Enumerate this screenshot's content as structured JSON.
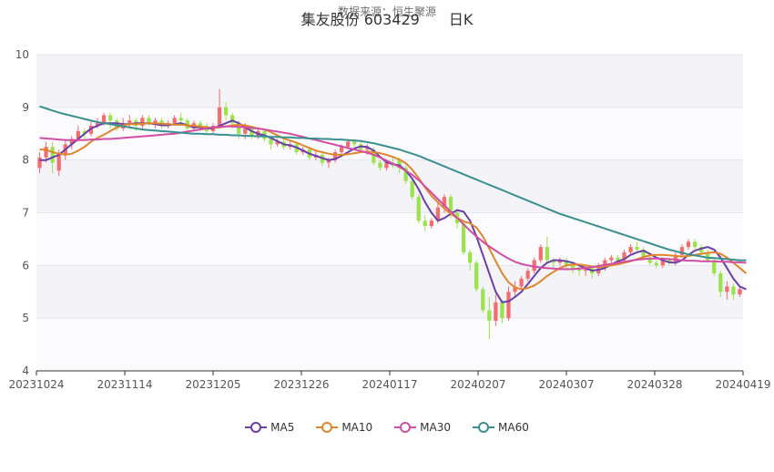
{
  "header": {
    "title": "集友股份 603429　　日K",
    "subtitle": "数据来源：恒生聚源"
  },
  "chart_data": {
    "type": "candlestick",
    "title": "集友股份 603429　　日K",
    "ylim": [
      4,
      10
    ],
    "y_ticks": [
      "4",
      "5",
      "6",
      "7",
      "8",
      "9",
      "10"
    ],
    "x_tick_labels": [
      "20231024",
      "20231114",
      "20231205",
      "20231226",
      "20240117",
      "20240207",
      "20240307",
      "20240328",
      "20240419"
    ],
    "grid": true,
    "legend_position": "bottom",
    "up_color": "#f26d6d",
    "down_color": "#9be34b",
    "candles": [
      {
        "o": 7.85,
        "c": 8.05,
        "h": 8.15,
        "l": 7.75
      },
      {
        "o": 8.05,
        "c": 8.25,
        "h": 8.35,
        "l": 7.95
      },
      {
        "o": 8.25,
        "c": 7.95,
        "h": 8.35,
        "l": 7.75
      },
      {
        "o": 7.8,
        "c": 8.1,
        "h": 8.2,
        "l": 7.7
      },
      {
        "o": 8.1,
        "c": 8.3,
        "h": 8.4,
        "l": 8.0
      },
      {
        "o": 8.3,
        "c": 8.4,
        "h": 8.45,
        "l": 8.2
      },
      {
        "o": 8.4,
        "c": 8.55,
        "h": 8.65,
        "l": 8.35
      },
      {
        "o": 8.55,
        "c": 8.5,
        "h": 8.6,
        "l": 8.4
      },
      {
        "o": 8.5,
        "c": 8.65,
        "h": 8.75,
        "l": 8.45
      },
      {
        "o": 8.65,
        "c": 8.7,
        "h": 8.8,
        "l": 8.6
      },
      {
        "o": 8.7,
        "c": 8.85,
        "h": 8.9,
        "l": 8.65
      },
      {
        "o": 8.85,
        "c": 8.75,
        "h": 8.9,
        "l": 8.6
      },
      {
        "o": 8.75,
        "c": 8.6,
        "h": 8.8,
        "l": 8.55
      },
      {
        "o": 8.6,
        "c": 8.7,
        "h": 8.8,
        "l": 8.55
      },
      {
        "o": 8.7,
        "c": 8.75,
        "h": 8.85,
        "l": 8.6
      },
      {
        "o": 8.75,
        "c": 8.65,
        "h": 8.8,
        "l": 8.55
      },
      {
        "o": 8.65,
        "c": 8.8,
        "h": 8.85,
        "l": 8.6
      },
      {
        "o": 8.8,
        "c": 8.7,
        "h": 8.85,
        "l": 8.65
      },
      {
        "o": 8.7,
        "c": 8.75,
        "h": 8.8,
        "l": 8.6
      },
      {
        "o": 8.75,
        "c": 8.65,
        "h": 8.8,
        "l": 8.6
      },
      {
        "o": 8.65,
        "c": 8.7,
        "h": 8.75,
        "l": 8.6
      },
      {
        "o": 8.7,
        "c": 8.8,
        "h": 8.85,
        "l": 8.65
      },
      {
        "o": 8.8,
        "c": 8.75,
        "h": 8.9,
        "l": 8.7
      },
      {
        "o": 8.75,
        "c": 8.6,
        "h": 8.8,
        "l": 8.5
      },
      {
        "o": 8.6,
        "c": 8.7,
        "h": 8.75,
        "l": 8.55
      },
      {
        "o": 8.7,
        "c": 8.65,
        "h": 8.75,
        "l": 8.55
      },
      {
        "o": 8.65,
        "c": 8.55,
        "h": 8.7,
        "l": 8.5
      },
      {
        "o": 8.55,
        "c": 8.65,
        "h": 8.7,
        "l": 8.5
      },
      {
        "o": 8.65,
        "c": 9.0,
        "h": 9.35,
        "l": 8.6
      },
      {
        "o": 9.0,
        "c": 8.85,
        "h": 9.1,
        "l": 8.75
      },
      {
        "o": 8.85,
        "c": 8.7,
        "h": 8.9,
        "l": 8.6
      },
      {
        "o": 8.7,
        "c": 8.5,
        "h": 8.75,
        "l": 8.4
      },
      {
        "o": 8.5,
        "c": 8.6,
        "h": 8.7,
        "l": 8.4
      },
      {
        "o": 8.6,
        "c": 8.45,
        "h": 8.65,
        "l": 8.4
      },
      {
        "o": 8.45,
        "c": 8.55,
        "h": 8.6,
        "l": 8.4
      },
      {
        "o": 8.55,
        "c": 8.4,
        "h": 8.6,
        "l": 8.35
      },
      {
        "o": 8.4,
        "c": 8.3,
        "h": 8.45,
        "l": 8.2
      },
      {
        "o": 8.3,
        "c": 8.35,
        "h": 8.4,
        "l": 8.25
      },
      {
        "o": 8.35,
        "c": 8.25,
        "h": 8.4,
        "l": 8.2
      },
      {
        "o": 8.25,
        "c": 8.3,
        "h": 8.35,
        "l": 8.2
      },
      {
        "o": 8.3,
        "c": 8.15,
        "h": 8.35,
        "l": 8.1
      },
      {
        "o": 8.15,
        "c": 8.2,
        "h": 8.25,
        "l": 8.1
      },
      {
        "o": 8.2,
        "c": 8.05,
        "h": 8.25,
        "l": 8.0
      },
      {
        "o": 8.05,
        "c": 8.1,
        "h": 8.2,
        "l": 8.0
      },
      {
        "o": 8.1,
        "c": 7.95,
        "h": 8.15,
        "l": 7.9
      },
      {
        "o": 7.95,
        "c": 8.0,
        "h": 8.05,
        "l": 7.85
      },
      {
        "o": 8.0,
        "c": 8.15,
        "h": 8.2,
        "l": 7.95
      },
      {
        "o": 8.15,
        "c": 8.25,
        "h": 8.3,
        "l": 8.1
      },
      {
        "o": 8.25,
        "c": 8.35,
        "h": 8.4,
        "l": 8.2
      },
      {
        "o": 8.35,
        "c": 8.3,
        "h": 8.4,
        "l": 8.25
      },
      {
        "o": 8.3,
        "c": 8.2,
        "h": 8.35,
        "l": 8.15
      },
      {
        "o": 8.2,
        "c": 8.25,
        "h": 8.3,
        "l": 8.1
      },
      {
        "o": 8.2,
        "c": 7.95,
        "h": 8.25,
        "l": 7.9
      },
      {
        "o": 7.95,
        "c": 7.85,
        "h": 8.0,
        "l": 7.8
      },
      {
        "o": 7.85,
        "c": 7.95,
        "h": 8.0,
        "l": 7.8
      },
      {
        "o": 7.95,
        "c": 7.9,
        "h": 8.05,
        "l": 7.85
      },
      {
        "o": 8.0,
        "c": 7.85,
        "h": 8.05,
        "l": 7.75
      },
      {
        "o": 7.85,
        "c": 7.6,
        "h": 7.9,
        "l": 7.55
      },
      {
        "o": 7.6,
        "c": 7.3,
        "h": 7.65,
        "l": 7.25
      },
      {
        "o": 7.3,
        "c": 6.85,
        "h": 7.35,
        "l": 6.8
      },
      {
        "o": 6.85,
        "c": 6.75,
        "h": 6.95,
        "l": 6.65
      },
      {
        "o": 6.75,
        "c": 6.85,
        "h": 6.9,
        "l": 6.7
      },
      {
        "o": 6.85,
        "c": 7.1,
        "h": 7.2,
        "l": 6.8
      },
      {
        "o": 7.1,
        "c": 7.3,
        "h": 7.35,
        "l": 7.0
      },
      {
        "o": 7.3,
        "c": 7.0,
        "h": 7.35,
        "l": 6.9
      },
      {
        "o": 7.0,
        "c": 6.8,
        "h": 7.05,
        "l": 6.7
      },
      {
        "o": 6.8,
        "c": 6.25,
        "h": 6.85,
        "l": 6.2
      },
      {
        "o": 6.25,
        "c": 6.05,
        "h": 6.3,
        "l": 5.9
      },
      {
        "o": 6.05,
        "c": 5.55,
        "h": 6.1,
        "l": 5.5
      },
      {
        "o": 5.55,
        "c": 5.15,
        "h": 5.6,
        "l": 5.1
      },
      {
        "o": 5.15,
        "c": 4.95,
        "h": 5.4,
        "l": 4.6
      },
      {
        "o": 4.95,
        "c": 5.3,
        "h": 5.45,
        "l": 4.85
      },
      {
        "o": 5.3,
        "c": 5.0,
        "h": 5.35,
        "l": 4.9
      },
      {
        "o": 5.0,
        "c": 5.5,
        "h": 5.6,
        "l": 4.95
      },
      {
        "o": 5.5,
        "c": 5.6,
        "h": 5.7,
        "l": 5.4
      },
      {
        "o": 5.6,
        "c": 5.75,
        "h": 5.8,
        "l": 5.55
      },
      {
        "o": 5.75,
        "c": 5.9,
        "h": 5.95,
        "l": 5.7
      },
      {
        "o": 5.9,
        "c": 6.1,
        "h": 6.15,
        "l": 5.85
      },
      {
        "o": 6.1,
        "c": 6.35,
        "h": 6.4,
        "l": 6.05
      },
      {
        "o": 6.35,
        "c": 6.1,
        "h": 6.55,
        "l": 6.05
      },
      {
        "o": 6.1,
        "c": 6.05,
        "h": 6.15,
        "l": 5.95
      },
      {
        "o": 6.05,
        "c": 6.1,
        "h": 6.15,
        "l": 6.0
      },
      {
        "o": 6.1,
        "c": 6.0,
        "h": 6.15,
        "l": 5.9
      },
      {
        "o": 6.0,
        "c": 5.95,
        "h": 6.05,
        "l": 5.85
      },
      {
        "o": 5.95,
        "c": 5.9,
        "h": 6.0,
        "l": 5.8
      },
      {
        "o": 5.9,
        "c": 5.95,
        "h": 6.0,
        "l": 5.8
      },
      {
        "o": 5.95,
        "c": 5.85,
        "h": 6.0,
        "l": 5.75
      },
      {
        "o": 5.85,
        "c": 5.95,
        "h": 6.05,
        "l": 5.8
      },
      {
        "o": 5.95,
        "c": 6.1,
        "h": 6.15,
        "l": 5.9
      },
      {
        "o": 6.1,
        "c": 6.15,
        "h": 6.2,
        "l": 6.05
      },
      {
        "o": 6.15,
        "c": 6.1,
        "h": 6.2,
        "l": 6.05
      },
      {
        "o": 6.1,
        "c": 6.25,
        "h": 6.3,
        "l": 6.05
      },
      {
        "o": 6.25,
        "c": 6.35,
        "h": 6.4,
        "l": 6.2
      },
      {
        "o": 6.35,
        "c": 6.3,
        "h": 6.45,
        "l": 6.25
      },
      {
        "o": 6.3,
        "c": 6.15,
        "h": 6.35,
        "l": 6.1
      },
      {
        "o": 6.15,
        "c": 6.05,
        "h": 6.2,
        "l": 6.0
      },
      {
        "o": 6.05,
        "c": 6.0,
        "h": 6.1,
        "l": 5.95
      },
      {
        "o": 6.0,
        "c": 6.1,
        "h": 6.15,
        "l": 5.95
      },
      {
        "o": 6.1,
        "c": 6.05,
        "h": 6.15,
        "l": 6.0
      },
      {
        "o": 6.05,
        "c": 6.2,
        "h": 6.25,
        "l": 6.0
      },
      {
        "o": 6.2,
        "c": 6.35,
        "h": 6.4,
        "l": 6.15
      },
      {
        "o": 6.35,
        "c": 6.45,
        "h": 6.5,
        "l": 6.3
      },
      {
        "o": 6.45,
        "c": 6.35,
        "h": 6.5,
        "l": 6.3
      },
      {
        "o": 6.35,
        "c": 6.25,
        "h": 6.4,
        "l": 6.2
      },
      {
        "o": 6.25,
        "c": 6.1,
        "h": 6.3,
        "l": 6.05
      },
      {
        "o": 6.1,
        "c": 5.85,
        "h": 6.15,
        "l": 5.8
      },
      {
        "o": 5.85,
        "c": 5.5,
        "h": 5.9,
        "l": 5.4
      },
      {
        "o": 5.5,
        "c": 5.6,
        "h": 5.7,
        "l": 5.35
      },
      {
        "o": 5.6,
        "c": 5.45,
        "h": 5.65,
        "l": 5.35
      },
      {
        "o": 5.45,
        "c": 5.55,
        "h": 5.6,
        "l": 5.4
      }
    ],
    "series": [
      {
        "name": "MA5",
        "color": "#6a40a8",
        "values": [
          8.0,
          8.0,
          8.05,
          8.1,
          8.2,
          8.3,
          8.4,
          8.5,
          8.6,
          8.65,
          8.7,
          8.7,
          8.7,
          8.68,
          8.68,
          8.7,
          8.7,
          8.7,
          8.68,
          8.66,
          8.66,
          8.68,
          8.7,
          8.66,
          8.62,
          8.62,
          8.6,
          8.6,
          8.65,
          8.7,
          8.75,
          8.7,
          8.62,
          8.55,
          8.5,
          8.47,
          8.42,
          8.36,
          8.3,
          8.28,
          8.24,
          8.18,
          8.12,
          8.08,
          8.04,
          8.0,
          8.02,
          8.08,
          8.15,
          8.22,
          8.26,
          8.25,
          8.18,
          8.06,
          7.96,
          7.92,
          7.9,
          7.8,
          7.65,
          7.45,
          7.2,
          7.0,
          6.85,
          6.9,
          6.98,
          7.05,
          7.02,
          6.85,
          6.55,
          6.2,
          5.85,
          5.5,
          5.3,
          5.32,
          5.4,
          5.5,
          5.65,
          5.8,
          5.95,
          6.05,
          6.1,
          6.1,
          6.08,
          6.05,
          6.0,
          5.95,
          5.9,
          5.92,
          5.95,
          6.02,
          6.08,
          6.12,
          6.2,
          6.25,
          6.28,
          6.22,
          6.15,
          6.1,
          6.06,
          6.05,
          6.1,
          6.2,
          6.28,
          6.32,
          6.35,
          6.3,
          6.15,
          5.95,
          5.75,
          5.6,
          5.55
        ]
      },
      {
        "name": "MA10",
        "color": "#e0852b",
        "values": [
          8.2,
          8.2,
          8.15,
          8.12,
          8.1,
          8.12,
          8.18,
          8.25,
          8.35,
          8.42,
          8.48,
          8.55,
          8.62,
          8.66,
          8.68,
          8.68,
          8.69,
          8.7,
          8.7,
          8.69,
          8.68,
          8.67,
          8.67,
          8.66,
          8.65,
          8.64,
          8.62,
          8.61,
          8.62,
          8.64,
          8.66,
          8.67,
          8.66,
          8.63,
          8.6,
          8.58,
          8.53,
          8.47,
          8.41,
          8.37,
          8.33,
          8.28,
          8.23,
          8.18,
          8.15,
          8.12,
          8.1,
          8.1,
          8.11,
          8.13,
          8.15,
          8.16,
          8.15,
          8.13,
          8.1,
          8.06,
          8.01,
          7.94,
          7.82,
          7.66,
          7.48,
          7.32,
          7.2,
          7.08,
          6.98,
          6.9,
          6.84,
          6.8,
          6.72,
          6.55,
          6.32,
          6.08,
          5.85,
          5.68,
          5.58,
          5.55,
          5.57,
          5.62,
          5.7,
          5.8,
          5.88,
          5.95,
          6.0,
          6.02,
          6.02,
          6.0,
          5.98,
          5.97,
          5.98,
          6.0,
          6.02,
          6.05,
          6.08,
          6.12,
          6.16,
          6.19,
          6.2,
          6.2,
          6.19,
          6.18,
          6.17,
          6.18,
          6.2,
          6.22,
          6.24,
          6.25,
          6.22,
          6.15,
          6.05,
          5.95,
          5.85
        ]
      },
      {
        "name": "MA30",
        "color": "#d24ea5",
        "values": [
          8.42,
          8.41,
          8.4,
          8.39,
          8.38,
          8.38,
          8.38,
          8.38,
          8.39,
          8.39,
          8.4,
          8.4,
          8.41,
          8.42,
          8.43,
          8.44,
          8.45,
          8.46,
          8.47,
          8.48,
          8.49,
          8.5,
          8.52,
          8.54,
          8.56,
          8.58,
          8.6,
          8.62,
          8.63,
          8.64,
          8.64,
          8.63,
          8.62,
          8.61,
          8.6,
          8.58,
          8.56,
          8.54,
          8.52,
          8.5,
          8.47,
          8.44,
          8.41,
          8.38,
          8.35,
          8.32,
          8.29,
          8.26,
          8.23,
          8.2,
          8.17,
          8.14,
          8.1,
          8.05,
          7.99,
          7.93,
          7.87,
          7.8,
          7.72,
          7.62,
          7.5,
          7.38,
          7.26,
          7.14,
          7.02,
          6.9,
          6.78,
          6.66,
          6.55,
          6.45,
          6.36,
          6.28,
          6.2,
          6.13,
          6.07,
          6.03,
          6.0,
          5.98,
          5.96,
          5.95,
          5.94,
          5.93,
          5.93,
          5.93,
          5.94,
          5.95,
          5.97,
          5.99,
          6.01,
          6.03,
          6.05,
          6.07,
          6.09,
          6.11,
          6.12,
          6.13,
          6.13,
          6.13,
          6.12,
          6.11,
          6.1,
          6.09,
          6.09,
          6.08,
          6.08,
          6.08,
          6.07,
          6.07,
          6.06,
          6.06,
          6.05
        ]
      },
      {
        "name": "MA60",
        "color": "#3a8f8f",
        "values": [
          9.02,
          8.98,
          8.94,
          8.9,
          8.87,
          8.84,
          8.81,
          8.78,
          8.75,
          8.72,
          8.7,
          8.68,
          8.66,
          8.64,
          8.62,
          8.6,
          8.58,
          8.57,
          8.56,
          8.55,
          8.54,
          8.53,
          8.52,
          8.51,
          8.5,
          8.5,
          8.49,
          8.49,
          8.48,
          8.48,
          8.47,
          8.47,
          8.46,
          8.46,
          8.45,
          8.45,
          8.44,
          8.44,
          8.43,
          8.43,
          8.42,
          8.42,
          8.41,
          8.41,
          8.4,
          8.4,
          8.39,
          8.39,
          8.38,
          8.37,
          8.36,
          8.34,
          8.32,
          8.29,
          8.26,
          8.23,
          8.2,
          8.16,
          8.12,
          8.08,
          8.03,
          7.98,
          7.93,
          7.88,
          7.83,
          7.78,
          7.73,
          7.68,
          7.63,
          7.58,
          7.53,
          7.48,
          7.43,
          7.38,
          7.33,
          7.28,
          7.23,
          7.18,
          7.13,
          7.08,
          7.03,
          6.98,
          6.94,
          6.9,
          6.86,
          6.82,
          6.78,
          6.74,
          6.7,
          6.66,
          6.62,
          6.58,
          6.54,
          6.5,
          6.46,
          6.42,
          6.38,
          6.34,
          6.3,
          6.27,
          6.24,
          6.21,
          6.19,
          6.17,
          6.15,
          6.14,
          6.13,
          6.12,
          6.11,
          6.1,
          6.1
        ]
      }
    ]
  }
}
